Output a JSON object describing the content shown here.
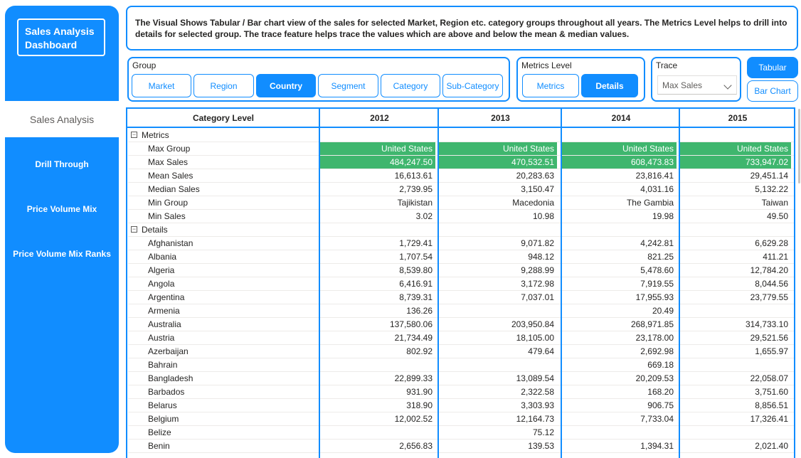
{
  "sidebar": {
    "title": "Sales Analysis Dashboard",
    "active_item": "Sales Analysis",
    "items": [
      "Drill Through",
      "Price Volume Mix",
      "Price Volume Mix Ranks"
    ]
  },
  "description": "The Visual Shows Tabular / Bar chart view of the sales for selected Market, Region etc. category groups throughout all years. The Metrics Level helps to drill into details for selected group. The trace feature helps trace the values which are above and below the mean & median values.",
  "group": {
    "label": "Group",
    "options": [
      "Market",
      "Region",
      "Country",
      "Segment",
      "Category",
      "Sub-Category"
    ],
    "selected": "Country"
  },
  "metrics_level": {
    "label": "Metrics Level",
    "options": [
      "Metrics",
      "Details"
    ],
    "selected": "Details"
  },
  "trace": {
    "label": "Trace",
    "value": "Max Sales",
    "chevron_icon": "chevron-down-icon"
  },
  "view_buttons": [
    "Tabular",
    "Bar Chart"
  ],
  "view_selected": "Tabular",
  "colors": {
    "accent": "#118DFF",
    "highlight": "#3FB66E"
  },
  "table": {
    "headers": [
      "Category Level",
      "2012",
      "2013",
      "2014",
      "2015"
    ],
    "rows": [
      {
        "kind": "group",
        "label": "Metrics",
        "toggle": "⊟",
        "values": [
          "",
          "",
          "",
          ""
        ]
      },
      {
        "kind": "item",
        "label": "Max Group",
        "hl": true,
        "values": [
          "United States",
          "United States",
          "United States",
          "United States"
        ]
      },
      {
        "kind": "item",
        "label": "Max Sales",
        "hl": true,
        "values": [
          "484,247.50",
          "470,532.51",
          "608,473.83",
          "733,947.02"
        ]
      },
      {
        "kind": "item",
        "label": "Mean Sales",
        "values": [
          "16,613.61",
          "20,283.63",
          "23,816.41",
          "29,451.14"
        ]
      },
      {
        "kind": "item",
        "label": "Median Sales",
        "values": [
          "2,739.95",
          "3,150.47",
          "4,031.16",
          "5,132.22"
        ]
      },
      {
        "kind": "item",
        "label": "Min Group",
        "values": [
          "Tajikistan",
          "Macedonia",
          "The Gambia",
          "Taiwan"
        ]
      },
      {
        "kind": "item",
        "label": "Min Sales",
        "values": [
          "3.02",
          "10.98",
          "19.98",
          "49.50"
        ]
      },
      {
        "kind": "group",
        "label": "Details",
        "toggle": "⊟",
        "values": [
          "",
          "",
          "",
          ""
        ]
      },
      {
        "kind": "item",
        "label": "Afghanistan",
        "values": [
          "1,729.41",
          "9,071.82",
          "4,242.81",
          "6,629.28"
        ]
      },
      {
        "kind": "item",
        "label": "Albania",
        "values": [
          "1,707.54",
          "948.12",
          "821.25",
          "411.21"
        ]
      },
      {
        "kind": "item",
        "label": "Algeria",
        "values": [
          "8,539.80",
          "9,288.99",
          "5,478.60",
          "12,784.20"
        ]
      },
      {
        "kind": "item",
        "label": "Angola",
        "values": [
          "6,416.91",
          "3,172.98",
          "7,919.55",
          "8,044.56"
        ]
      },
      {
        "kind": "item",
        "label": "Argentina",
        "values": [
          "8,739.31",
          "7,037.01",
          "17,955.93",
          "23,779.55"
        ]
      },
      {
        "kind": "item",
        "label": "Armenia",
        "values": [
          "136.26",
          "",
          "20.49",
          ""
        ]
      },
      {
        "kind": "item",
        "label": "Australia",
        "values": [
          "137,580.06",
          "203,950.84",
          "268,971.85",
          "314,733.10"
        ]
      },
      {
        "kind": "item",
        "label": "Austria",
        "values": [
          "21,734.49",
          "18,105.00",
          "23,178.00",
          "29,521.56"
        ]
      },
      {
        "kind": "item",
        "label": "Azerbaijan",
        "values": [
          "802.92",
          "479.64",
          "2,692.98",
          "1,655.97"
        ]
      },
      {
        "kind": "item",
        "label": "Bahrain",
        "values": [
          "",
          "",
          "669.18",
          ""
        ]
      },
      {
        "kind": "item",
        "label": "Bangladesh",
        "values": [
          "22,899.33",
          "13,089.54",
          "20,209.53",
          "22,058.07"
        ]
      },
      {
        "kind": "item",
        "label": "Barbados",
        "values": [
          "931.90",
          "2,322.58",
          "168.20",
          "3,751.60"
        ]
      },
      {
        "kind": "item",
        "label": "Belarus",
        "values": [
          "318.90",
          "3,303.93",
          "906.75",
          "8,856.51"
        ]
      },
      {
        "kind": "item",
        "label": "Belgium",
        "values": [
          "12,002.52",
          "12,164.73",
          "7,733.04",
          "17,326.41"
        ]
      },
      {
        "kind": "item",
        "label": "Belize",
        "values": [
          "",
          "75.12",
          "",
          ""
        ]
      },
      {
        "kind": "item",
        "label": "Benin",
        "values": [
          "2,656.83",
          "139.53",
          "1,394.31",
          "2,021.40"
        ]
      }
    ]
  }
}
